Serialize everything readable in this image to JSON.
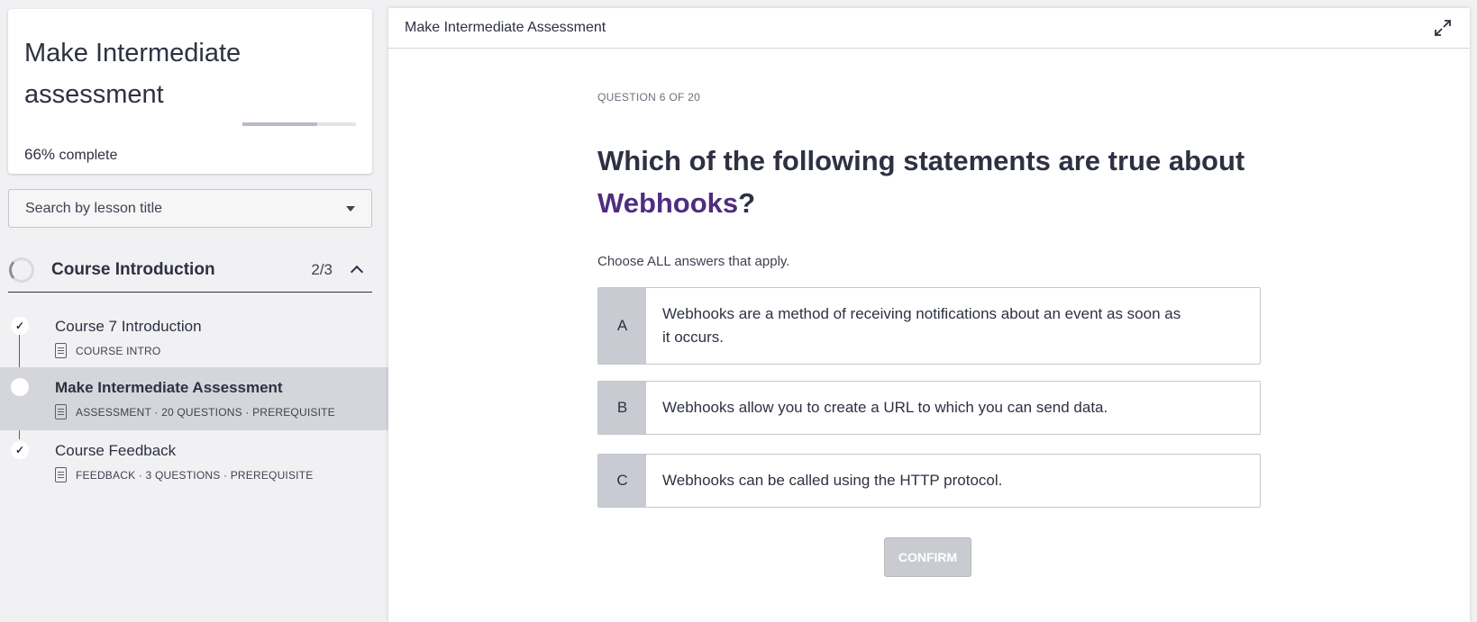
{
  "sidebar": {
    "title": "Make Intermediate assessment",
    "progress_percent": 66,
    "progress_pct_text": "66%",
    "progress_suffix": " complete",
    "search_placeholder": "Search by lesson title",
    "section": {
      "title": "Course Introduction",
      "count": "2/3"
    },
    "lessons": [
      {
        "name": "Course 7 Introduction",
        "meta": "COURSE INTRO",
        "status": "completed",
        "icon": "document-icon"
      },
      {
        "name": "Make Intermediate Assessment",
        "meta": "ASSESSMENT · 20 QUESTIONS · PREREQUISITE",
        "status": "current",
        "icon": "assessment-icon"
      },
      {
        "name": "Course Feedback",
        "meta": "FEEDBACK · 3 QUESTIONS · PREREQUISITE",
        "status": "completed",
        "icon": "feedback-icon"
      }
    ]
  },
  "main": {
    "header_title": "Make Intermediate Assessment",
    "question_counter": "QUESTION 6 OF 20",
    "question_prefix": "Which of the following statements are true about ",
    "question_keyword": "Webhooks",
    "question_suffix": "?",
    "instructions": "Choose ALL answers that apply.",
    "options": [
      {
        "letter": "A",
        "text": "Webhooks are a method of receiving notifications about an event as soon as it occurs."
      },
      {
        "letter": "B",
        "text": "Webhooks allow you to create a URL to which you can send data."
      },
      {
        "letter": "C",
        "text": "Webhooks can be called using the HTTP protocol."
      }
    ],
    "confirm_label": "CONFIRM"
  },
  "colors": {
    "keyword": "#4f2d7f",
    "active_row": "#d5d6db",
    "option_letter_bg": "#c9cbd3",
    "confirm_disabled": "#c9cbd0"
  }
}
